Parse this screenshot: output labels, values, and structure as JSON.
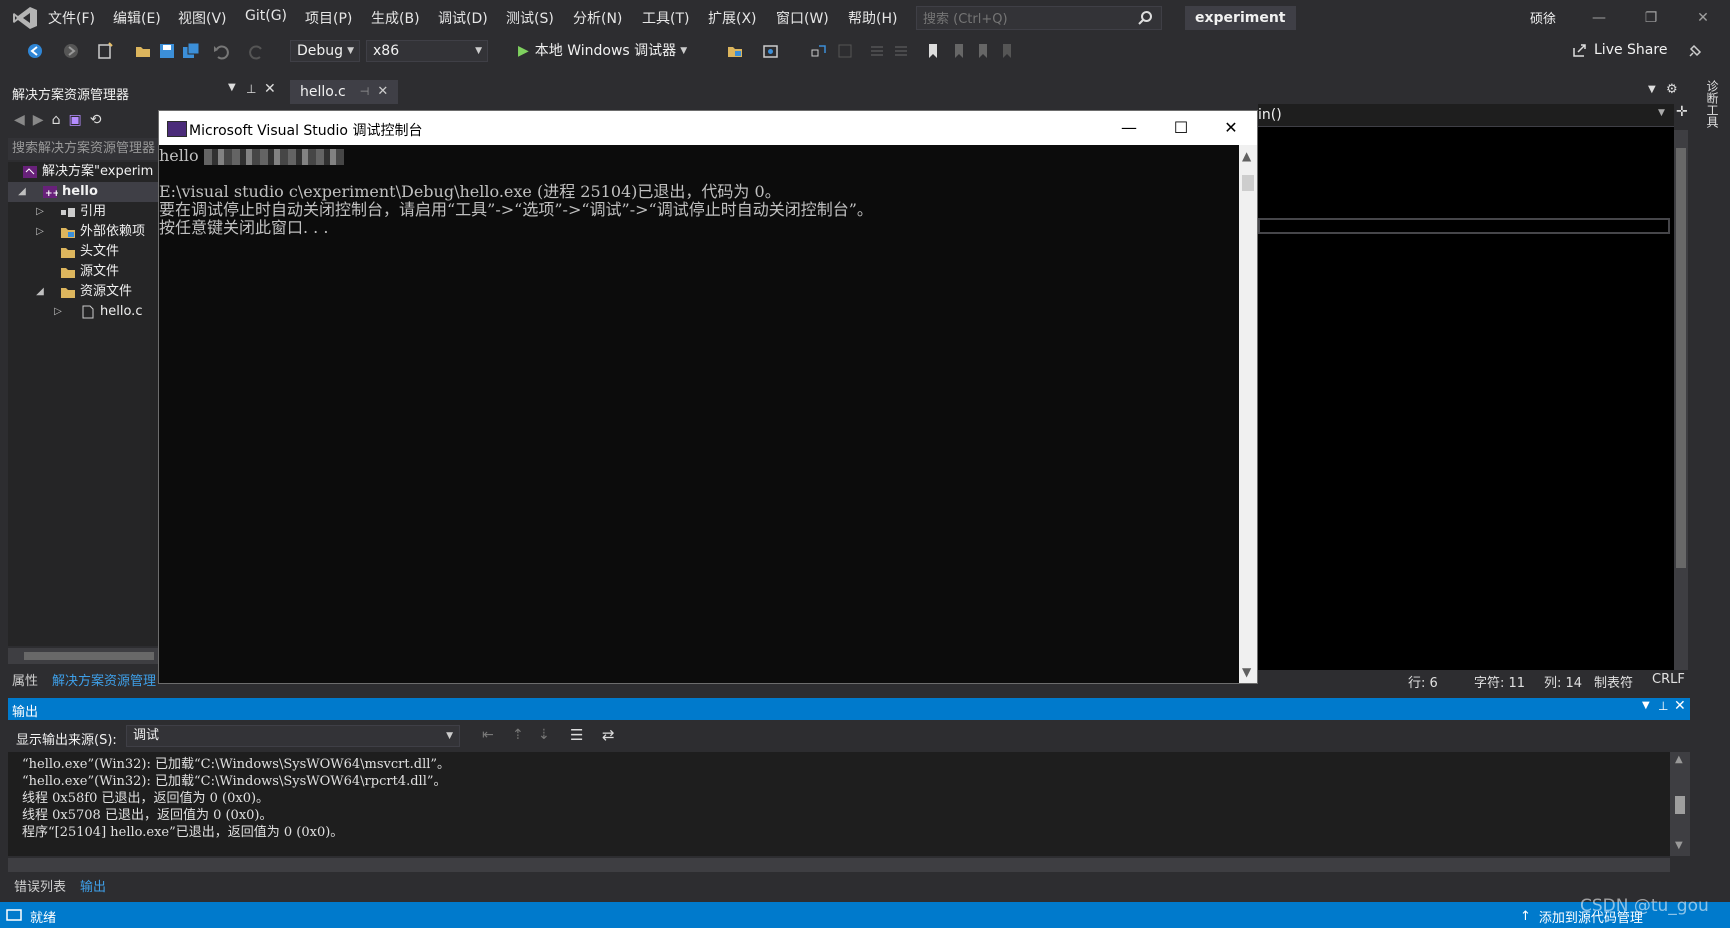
{
  "menu": {
    "items": [
      "文件(F)",
      "编辑(E)",
      "视图(V)",
      "Git(G)",
      "项目(P)",
      "生成(B)",
      "调试(D)",
      "测试(S)",
      "分析(N)",
      "工具(T)",
      "扩展(X)",
      "窗口(W)",
      "帮助(H)"
    ],
    "search_placeholder": "搜索 (Ctrl+Q)",
    "solution_name": "experiment",
    "user_initials": "硕徐"
  },
  "toolbar": {
    "config": "Debug",
    "platform": "x86",
    "run_label": "本地 Windows 调试器",
    "live_share": "Live Share"
  },
  "solution_explorer": {
    "title": "解决方案资源管理器",
    "search_placeholder": "搜索解决方案资源管理器",
    "tree": [
      {
        "label": "解决方案\"experim",
        "expander": ""
      },
      {
        "label": "hello",
        "expander": "◢"
      },
      {
        "label": "引用",
        "expander": "▷"
      },
      {
        "label": "外部依赖项",
        "expander": "▷"
      },
      {
        "label": "头文件",
        "expander": ""
      },
      {
        "label": "源文件",
        "expander": ""
      },
      {
        "label": "资源文件",
        "expander": "◢"
      },
      {
        "label": "hello.c",
        "expander": "▷"
      }
    ],
    "tab_properties": "属性",
    "tab_solution": "解决方案资源管理"
  },
  "editor": {
    "tab_label": "hello.c",
    "nav_text": "in()",
    "status": {
      "line": "行: 6",
      "char": "字符: 11",
      "col": "列: 14",
      "tabs": "制表符",
      "eol": "CRLF"
    }
  },
  "console": {
    "title": "Microsoft Visual Studio 调试控制台",
    "lines": [
      "hello",
      "",
      "E:\\visual studio c\\experiment\\Debug\\hello.exe (进程 25104)已退出，代码为 0。",
      "要在调试停止时自动关闭控制台，请启用“工具”->“选项”->“调试”->“调试停止时自动关闭控制台”。",
      "按任意键关闭此窗口. . ."
    ]
  },
  "output": {
    "title": "输出",
    "source_label": "显示输出来源(S):",
    "source_value": "调试",
    "lines": [
      "“hello.exe”(Win32): 已加载“C:\\Windows\\SysWOW64\\msvcrt.dll”。",
      "“hello.exe”(Win32): 已加载“C:\\Windows\\SysWOW64\\rpcrt4.dll”。",
      "线程 0x58f0 已退出，返回值为 0 (0x0)。",
      "线程 0x5708 已退出，返回值为 0 (0x0)。",
      "程序“[25104] hello.exe”已退出，返回值为 0 (0x0)。"
    ],
    "tab_errors": "错误列表",
    "tab_output": "输出"
  },
  "statusbar": {
    "ready": "就绪",
    "source_control": "添加到源代码管理",
    "watermark": "CSDN @tu_gou"
  },
  "diag_tools": "诊断工具"
}
